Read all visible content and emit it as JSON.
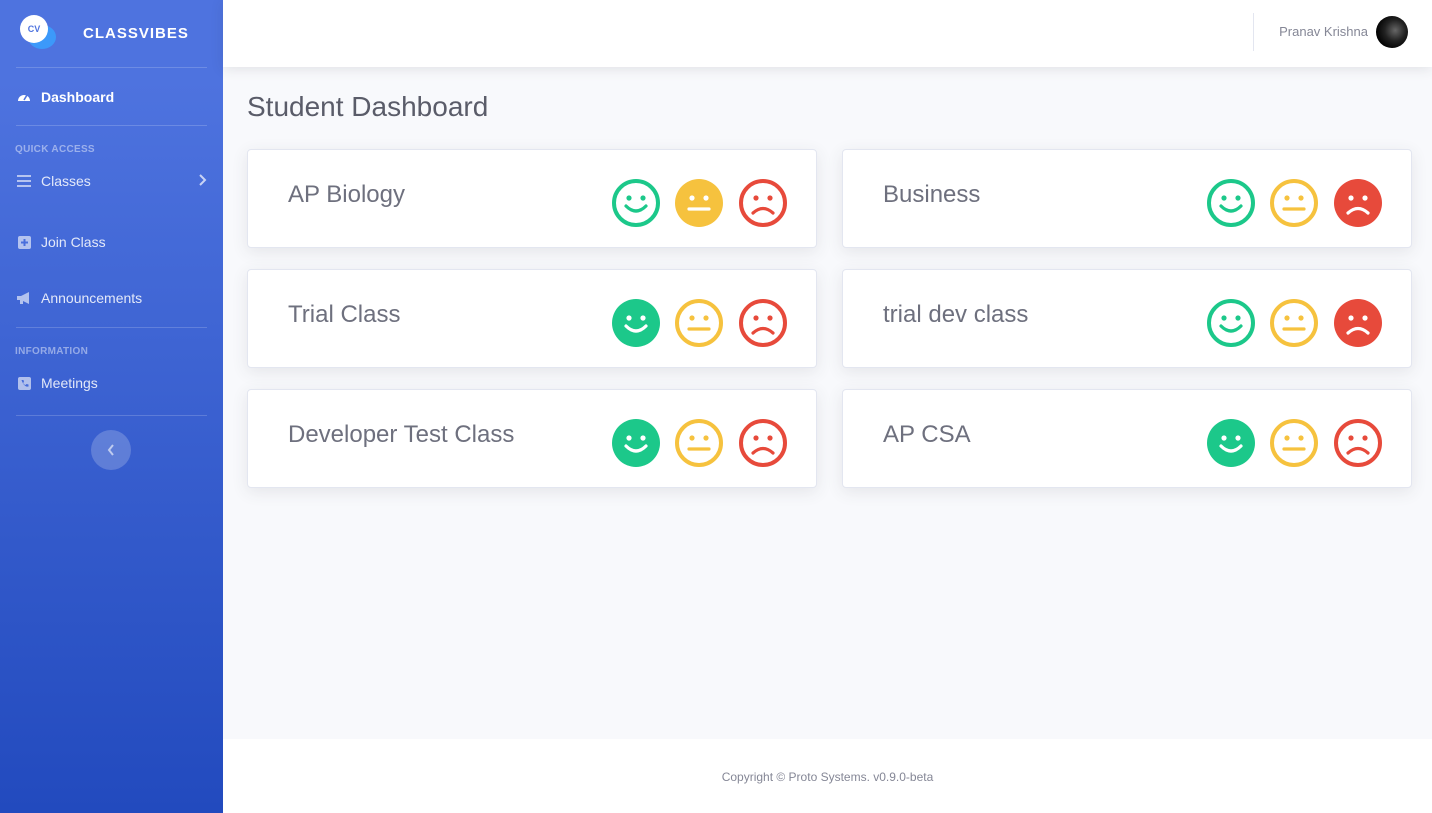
{
  "brand": {
    "name": "CLASSVIBES",
    "logo_text": "CV"
  },
  "sidebar": {
    "dashboard_label": "Dashboard",
    "quick_access_heading": "QUICK ACCESS",
    "classes_label": "Classes",
    "join_class_label": "Join Class",
    "announcements_label": "Announcements",
    "information_heading": "INFORMATION",
    "meetings_label": "Meetings"
  },
  "topbar": {
    "user_name": "Pranav Krishna"
  },
  "main": {
    "page_title": "Student Dashboard",
    "classes": [
      {
        "name": "AP Biology",
        "selected": "neutral"
      },
      {
        "name": "Business",
        "selected": "sad"
      },
      {
        "name": "Trial Class",
        "selected": "happy"
      },
      {
        "name": "trial dev class",
        "selected": "sad"
      },
      {
        "name": "Developer Test Class",
        "selected": "happy"
      },
      {
        "name": "AP CSA",
        "selected": "happy"
      }
    ]
  },
  "colors": {
    "happy": "#1cc88a",
    "neutral": "#f6c23e",
    "sad": "#e74a3b",
    "accent": "#4e73df"
  },
  "footer": {
    "text": "Copyright © Proto Systems. v0.9.0-beta"
  }
}
